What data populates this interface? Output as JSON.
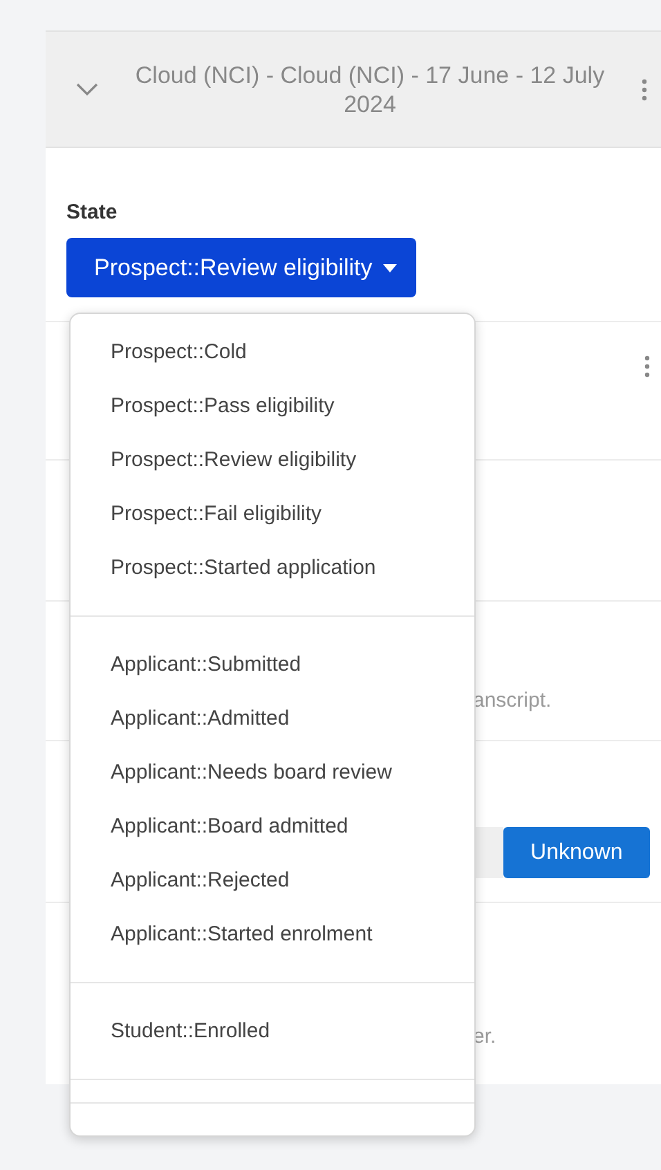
{
  "section_header": {
    "title": "Cloud (NCI) - Cloud (NCI) - 17 June - 12 July 2024",
    "expanded": true
  },
  "state_field": {
    "label": "State",
    "value": "Prospect::Review eligibility",
    "open": true
  },
  "state_menu": {
    "groups": [
      {
        "items": [
          "Prospect::Cold",
          "Prospect::Pass eligibility",
          "Prospect::Review eligibility",
          "Prospect::Fail eligibility",
          "Prospect::Started application"
        ]
      },
      {
        "items": [
          "Applicant::Submitted",
          "Applicant::Admitted",
          "Applicant::Needs board review",
          "Applicant::Board admitted",
          "Applicant::Rejected",
          "Applicant::Started enrolment"
        ]
      },
      {
        "items": [
          "Student::Enrolled"
        ]
      }
    ]
  },
  "background_rows": [
    {
      "kind": "menu"
    },
    {
      "kind": "empty"
    },
    {
      "kind": "text",
      "text": "anscript."
    },
    {
      "kind": "field",
      "button": "Unknown"
    },
    {
      "kind": "text",
      "text": "er."
    }
  ]
}
